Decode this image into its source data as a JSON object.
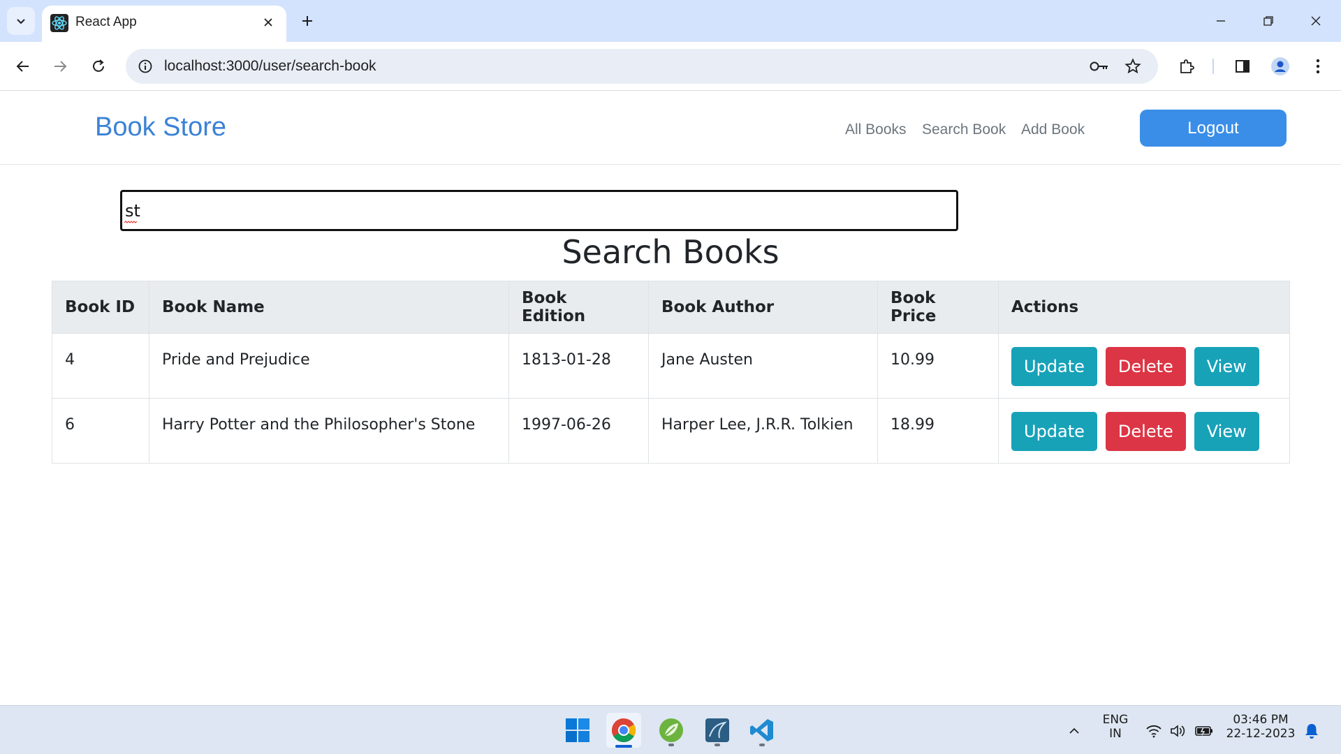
{
  "browser": {
    "tab_title": "React App",
    "url": "localhost:3000/user/search-book"
  },
  "app": {
    "brand": "Book Store",
    "nav_links": [
      "All Books",
      "Search Book",
      "Add Book"
    ],
    "logout_label": "Logout"
  },
  "search": {
    "value": "st"
  },
  "page": {
    "heading": "Search Books"
  },
  "table": {
    "headers": [
      "Book ID",
      "Book Name",
      "Book Edition",
      "Book Author",
      "Book Price",
      "Actions"
    ],
    "rows": [
      {
        "id": "4",
        "name": "Pride and Prejudice",
        "edition": "1813-01-28",
        "author": "Jane Austen",
        "price": "10.99"
      },
      {
        "id": "6",
        "name": "Harry Potter and the Philosopher's Stone",
        "edition": "1997-06-26",
        "author": "Harper Lee, J.R.R. Tolkien",
        "price": "18.99"
      }
    ],
    "actions": {
      "update": "Update",
      "delete": "Delete",
      "view": "View"
    }
  },
  "taskbar": {
    "lang_top": "ENG",
    "lang_bottom": "IN",
    "time": "03:46 PM",
    "date": "22-12-2023"
  },
  "colors": {
    "brand": "#3b82d6",
    "logout": "#3a8ee8",
    "info": "#17a2b8",
    "danger": "#dc3545"
  }
}
